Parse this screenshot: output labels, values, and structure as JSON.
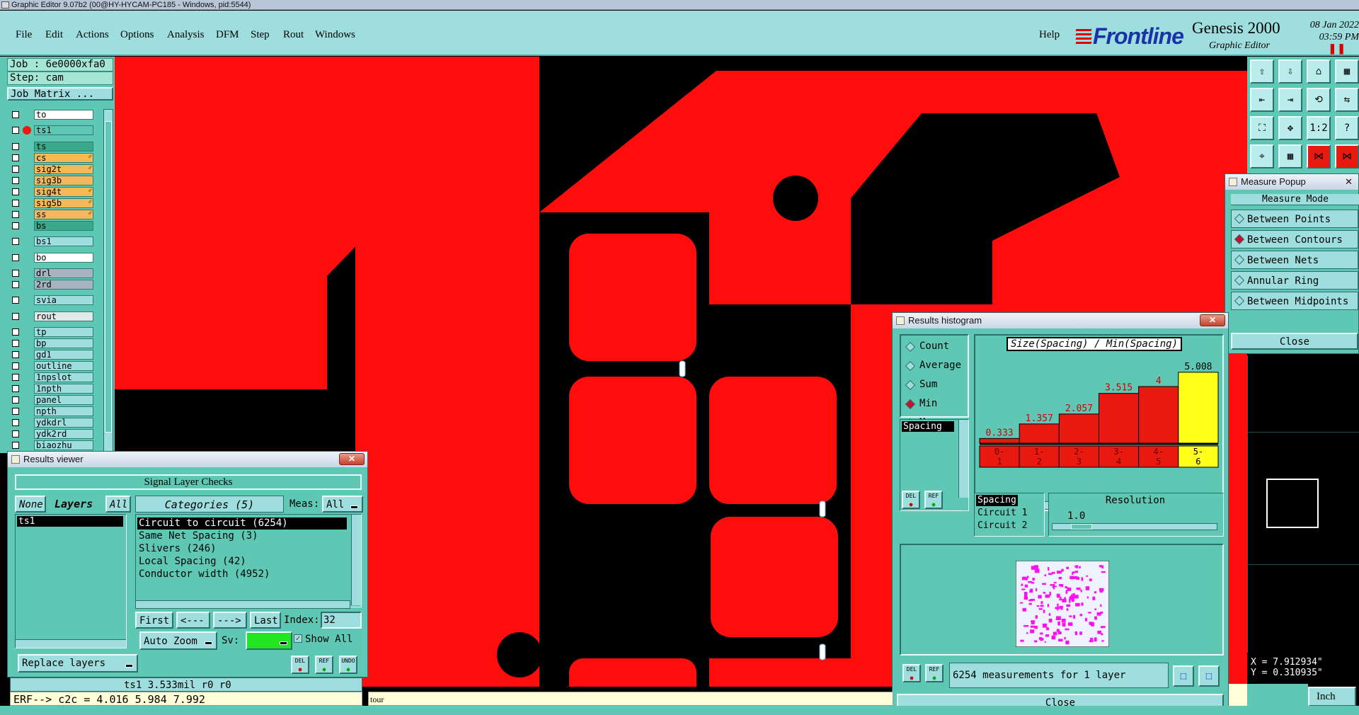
{
  "window": {
    "title": "Graphic Editor 9.07b2 (00@HY-HYCAM-PC185 - Windows, pid:5544)"
  },
  "menu": {
    "items": [
      "File",
      "Edit",
      "Actions",
      "Options",
      "Analysis",
      "DFM",
      "Step",
      "Rout",
      "Windows"
    ],
    "help": "Help"
  },
  "brand": {
    "logo": "Frontline",
    "product": "Genesis 2000",
    "subtitle": "Graphic Editor",
    "date": "08 Jan 2022",
    "time": "03:59 PM"
  },
  "job": {
    "job_label": "Job : 6e0000xfa0",
    "step_label": "Step: cam",
    "matrix_button": "Job Matrix ..."
  },
  "layers": [
    {
      "name": "to",
      "color": "#ffffff",
      "flag": ""
    },
    {
      "name": "ts1",
      "color": "#5fc8b4",
      "flag": ""
    },
    {
      "name": "ts",
      "color": "#3aa88a",
      "flag": ""
    },
    {
      "name": "cs",
      "color": "#f5b95a",
      "flag": "✐"
    },
    {
      "name": "sig2t",
      "color": "#f5b95a",
      "flag": "✐"
    },
    {
      "name": "sig3b",
      "color": "#f5b95a",
      "flag": ""
    },
    {
      "name": "sig4t",
      "color": "#f5b95a",
      "flag": "✐"
    },
    {
      "name": "sig5b",
      "color": "#f5b95a",
      "flag": "✐"
    },
    {
      "name": "ss",
      "color": "#f5b95a",
      "flag": "✐"
    },
    {
      "name": "bs",
      "color": "#3aa88a",
      "flag": ""
    },
    {
      "name": "bs1",
      "color": "#9fdede",
      "flag": ""
    },
    {
      "name": "bo",
      "color": "#ffffff",
      "flag": ""
    },
    {
      "name": "drl",
      "color": "#a7b4c0",
      "flag": ""
    },
    {
      "name": "2rd",
      "color": "#a7b4c0",
      "flag": ""
    },
    {
      "name": "svia",
      "color": "#9fdede",
      "flag": ""
    },
    {
      "name": "rout",
      "color": "#e6e6e6",
      "flag": ""
    },
    {
      "name": "tp",
      "color": "#9fdede",
      "flag": ""
    },
    {
      "name": "bp",
      "color": "#9fdede",
      "flag": ""
    },
    {
      "name": "gd1",
      "color": "#9fdede",
      "flag": ""
    },
    {
      "name": "outline",
      "color": "#9fdede",
      "flag": ""
    },
    {
      "name": "1npslot",
      "color": "#9fdede",
      "flag": ""
    },
    {
      "name": "1npth",
      "color": "#9fdede",
      "flag": ""
    },
    {
      "name": "panel",
      "color": "#9fdede",
      "flag": ""
    },
    {
      "name": "npth",
      "color": "#9fdede",
      "flag": ""
    },
    {
      "name": "ydkdrl",
      "color": "#9fdede",
      "flag": ""
    },
    {
      "name": "ydk2rd",
      "color": "#9fdede",
      "flag": ""
    },
    {
      "name": "biaozhu",
      "color": "#9fdede",
      "flag": ""
    }
  ],
  "toolbar_icons": [
    "layer-up-icon",
    "layer-down-icon",
    "home-icon",
    "zoom-area-icon",
    "pan-left-icon",
    "pan-right-icon",
    "snap-icon",
    "flip-icon",
    "fit-icon",
    "center-icon",
    "ratio-icon",
    "help-icon",
    "measure-icon",
    "grid-icon",
    "net-icon",
    "highlight-icon"
  ],
  "toolbar_labels": {
    "ratio": "1:2",
    "help": "?"
  },
  "measure_popup": {
    "title": "Measure Popup",
    "mode_label": "Measure Mode",
    "modes": [
      "Between Points",
      "Between Contours",
      "Between Nets",
      "Annular Ring",
      "Between Midpoints"
    ],
    "selected": 1,
    "close": "Close"
  },
  "histogram": {
    "title": "Results histogram",
    "stats": [
      "Count",
      "Average",
      "Sum",
      "Min",
      "Max"
    ],
    "selected_stat": 3,
    "chart_title": "Size(Spacing) / Min(Spacing)",
    "bins": [
      "0-1",
      "1-2",
      "2-3",
      "3-4",
      "4-5",
      "5-6"
    ],
    "values": [
      0.333,
      1.357,
      2.057,
      3.515,
      4,
      5.008
    ],
    "value_labels": [
      "0.333",
      "1.357",
      "2.057",
      "3.515",
      "4",
      "5.008"
    ],
    "highlight_index": 5,
    "bar_color": "#e8190f",
    "highlight_color": "#ffff1a",
    "list_item": "Spacing",
    "sel_items": [
      "Spacing",
      "Circuit 1",
      "Circuit 2"
    ],
    "resolution_label": "Resolution",
    "resolution_value": "1.0",
    "summary": "6254 measurements for 1 layer",
    "close": "Close",
    "del": "DEL",
    "ref": "REF"
  },
  "results_viewer": {
    "title": "Results viewer",
    "header": "Signal Layer Checks",
    "none_btn": "None",
    "layers_label": "Layers",
    "all_btn": "All",
    "categories_label": "Categories (5)",
    "meas_label": "Meas:",
    "meas_value": "All",
    "layer_list": [
      "ts1"
    ],
    "categories": [
      "Circuit to circuit (6254)",
      "Same Net Spacing (3)",
      "Slivers (246)",
      "Local Spacing (42)",
      "Conductor width (4952)"
    ],
    "nav": {
      "first": "First",
      "prev": "<---",
      "next": "--->",
      "last": "Last",
      "index_label": "Index:",
      "index_value": "32"
    },
    "autozoom": "Auto Zoom",
    "sv_label": "Sv:",
    "show_all": "Show All",
    "replace": "Replace layers",
    "del": "DEL",
    "ref": "REF",
    "undo": "UNDO"
  },
  "status": {
    "line1": "ts1 3.533mil  r0  r0",
    "line2": "ERF--> c2c = 4.016 5.984 7.992",
    "hint": "tour"
  },
  "coords": {
    "x": "X = 7.912934\"",
    "y": "Y = 0.310935\""
  },
  "unit": "Inch"
}
